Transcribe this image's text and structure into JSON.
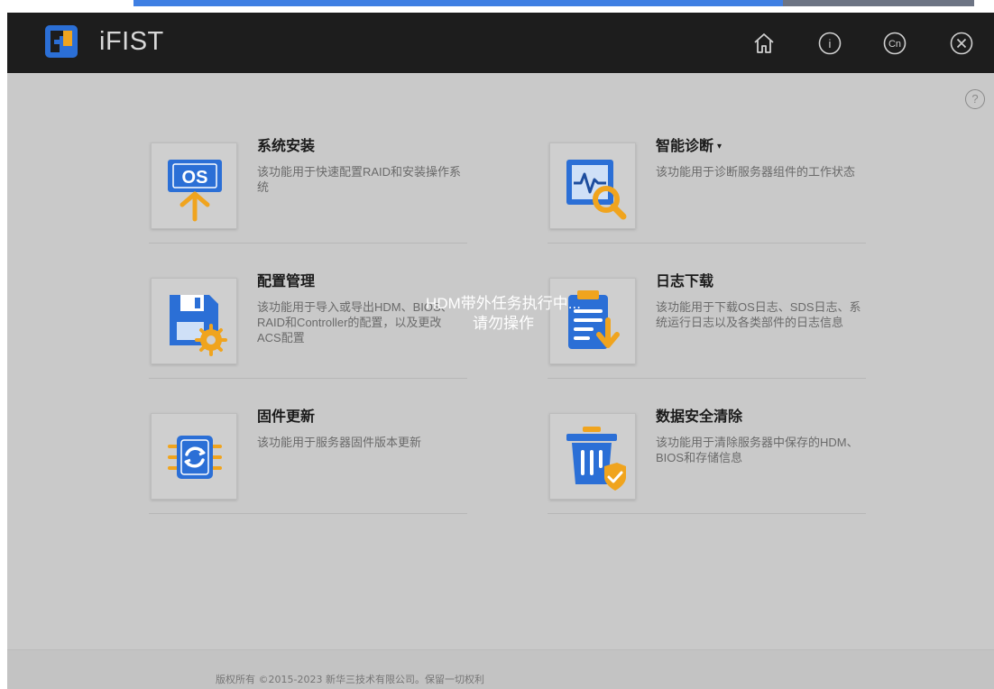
{
  "app": {
    "brand": "iFIST"
  },
  "colors": {
    "accent_blue": "#2b6fd6",
    "accent_yellow": "#f0a41e",
    "header_bg": "#1d1d1d"
  },
  "header": {
    "icons": [
      "home-icon",
      "info-icon",
      "language-icon",
      "close-icon"
    ],
    "language_label": "Cn",
    "info_label": "i"
  },
  "help": {
    "label": "?"
  },
  "cards": [
    {
      "title": "系统安装",
      "desc": "该功能用于快速配置RAID和安装操作系统",
      "icon": "os-install-icon",
      "os_text": "OS"
    },
    {
      "title": "智能诊断",
      "caret": "▾",
      "desc": "该功能用于诊断服务器组件的工作状态",
      "icon": "diagnostics-icon"
    },
    {
      "title": "配置管理",
      "desc": "该功能用于导入或导出HDM、BIOS、RAID和Controller的配置，以及更改ACS配置",
      "icon": "config-management-icon"
    },
    {
      "title": "日志下载",
      "desc": "该功能用于下载OS日志、SDS日志、系统运行日志以及各类部件的日志信息",
      "icon": "log-download-icon"
    },
    {
      "title": "固件更新",
      "desc": "该功能用于服务器固件版本更新",
      "icon": "firmware-update-icon"
    },
    {
      "title": "数据安全清除",
      "desc": "该功能用于清除服务器中保存的HDM、BIOS和存储信息",
      "icon": "data-erase-icon"
    }
  ],
  "overlay": {
    "line1": "HDM带外任务执行中...",
    "line2": "请勿操作"
  },
  "footer": {
    "copyright": "版权所有 ©2015-2023 新华三技术有限公司。保留一切权利"
  }
}
